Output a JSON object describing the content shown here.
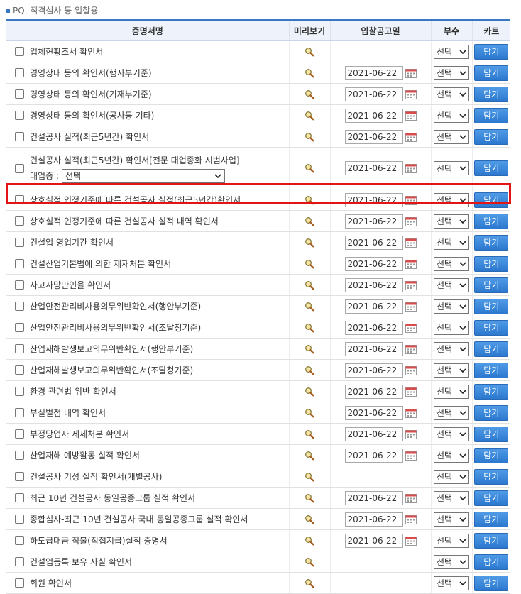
{
  "section_title": "PQ. 적격심사 등 입찰용",
  "table": {
    "headers": {
      "name": "증명서명",
      "preview": "미리보기",
      "date": "입찰공고일",
      "copies": "부수",
      "cart": "카트"
    },
    "default_select": "선택",
    "cart_label": "담기",
    "business_label": "대업종 :",
    "business_select": "선택",
    "rows": [
      {
        "name": "업체현황조서 확인서",
        "date": ""
      },
      {
        "name": "경영상태 등의 확인서(행자부기준)",
        "date": "2021-06-22"
      },
      {
        "name": "경영상태 등의 확인서(기재부기준)",
        "date": "2021-06-22"
      },
      {
        "name": "경영상태 등의 확인서(공사등 기타)",
        "date": "2021-06-22"
      },
      {
        "name": "건설공사 실적(최근5년간) 확인서",
        "date": "2021-06-22"
      },
      {
        "name": "건설공사 실적(최근5년간) 확인서[전문 대업종화 시범사업]",
        "date": "2021-06-22"
      },
      {
        "name": "상호실적 인정기준에 따른 건설공사 실적(최근5년간)확인서",
        "date": "2021-06-22"
      },
      {
        "name": "상호실적 인정기준에 따른 건설공사 실적 내역 확인서",
        "date": "2021-06-22"
      },
      {
        "name": "건설업 영업기간 확인서",
        "date": "2021-06-22"
      },
      {
        "name": "건설산업기본법에 의한 제재처분 확인서",
        "date": "2021-06-22"
      },
      {
        "name": "사고사망만인율 확인서",
        "date": "2021-06-22"
      },
      {
        "name": "산업안전관리비사용의무위반확인서(행안부기준)",
        "date": "2021-06-22"
      },
      {
        "name": "산업안전관리비사용의무위반확인서(조달청기준)",
        "date": "2021-06-22"
      },
      {
        "name": "산업재해발생보고의무위반확인서(행안부기준)",
        "date": "2021-06-22"
      },
      {
        "name": "산업재해발생보고의무위반확인서(조달청기준)",
        "date": "2021-06-22"
      },
      {
        "name": "환경 관련법 위반 확인서",
        "date": "2021-06-22"
      },
      {
        "name": "부실벌점 내역 확인서",
        "date": "2021-06-22"
      },
      {
        "name": "부정당업자 제제처분 확인서",
        "date": "2021-06-22"
      },
      {
        "name": "산업재해 예방활동 실적 확인서",
        "date": "2021-06-22"
      },
      {
        "name": "건설공사 기성 실적 확인서(개별공사)",
        "date": ""
      },
      {
        "name": "최근 10년 건설공사 동일공종그룹 실적 확인서",
        "date": "2021-06-22"
      },
      {
        "name": "종합심사-최근 10년 건설공사 국내 동일공종그룹 실적 확인서",
        "date": "2021-06-22"
      },
      {
        "name": "하도급대금 직불(직접지급)실적 증명서",
        "date": "2021-06-22"
      },
      {
        "name": "건설업등록 보유 사실 확인서",
        "date": ""
      },
      {
        "name": "회원 확인서",
        "date": ""
      }
    ]
  },
  "colors": {
    "accent": "#3a78c3",
    "header_bg": "#eef3fb",
    "button": "#2c78cf",
    "highlight": "#e41414"
  },
  "icons": {
    "preview": "magnifier-icon",
    "calendar": "calendar-icon",
    "dropdown": "chevron-down-icon"
  }
}
